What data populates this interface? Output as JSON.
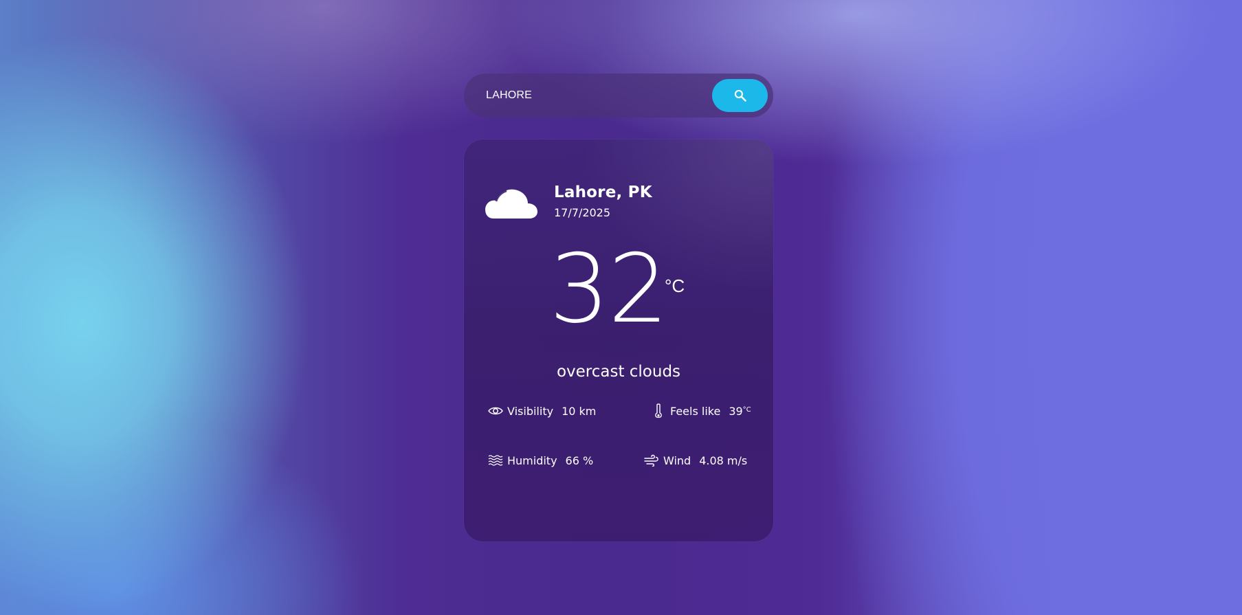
{
  "search": {
    "value": "LAHORE",
    "placeholder": ""
  },
  "current": {
    "location": "Lahore, PK",
    "date": "17/7/2025",
    "temperature": "32",
    "unit": "°C",
    "condition": "overcast clouds",
    "icon": "cloud-icon"
  },
  "stats": {
    "visibility": {
      "label": "Visibility",
      "value": "10 km",
      "icon": "eye-icon"
    },
    "feels_like": {
      "label": "Feels like",
      "value": "39",
      "unit": "°C",
      "icon": "thermometer-icon"
    },
    "humidity": {
      "label": "Humidity",
      "value": "66 %",
      "icon": "waves-icon"
    },
    "wind": {
      "label": "Wind",
      "value": "4.08 m/s",
      "icon": "wind-icon"
    }
  },
  "colors": {
    "search_button": "#1db8ea",
    "card_background": "#3e2476",
    "text": "#ffffff"
  }
}
